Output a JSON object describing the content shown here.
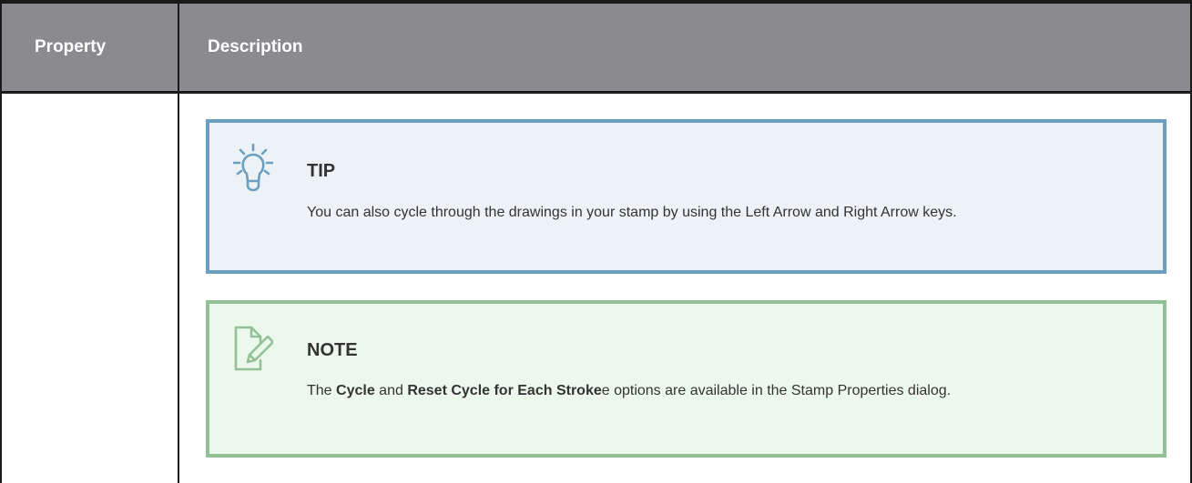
{
  "table": {
    "headers": {
      "property": "Property",
      "description": "Description"
    }
  },
  "tip": {
    "icon": "lightbulb-icon",
    "accent_color": "#6a9fbf",
    "title": "TIP",
    "text": "You can also cycle through the drawings in your stamp by using the Left Arrow and Right Arrow keys."
  },
  "note": {
    "icon": "note-pencil-icon",
    "accent_color": "#92c097",
    "title": "NOTE",
    "text_part1": "The ",
    "bold1": "Cycle",
    "text_part2": " and ",
    "bold2": "Reset Cycle for Each Stroke",
    "text_part3": "e options are available in the Stamp Properties dialog."
  }
}
